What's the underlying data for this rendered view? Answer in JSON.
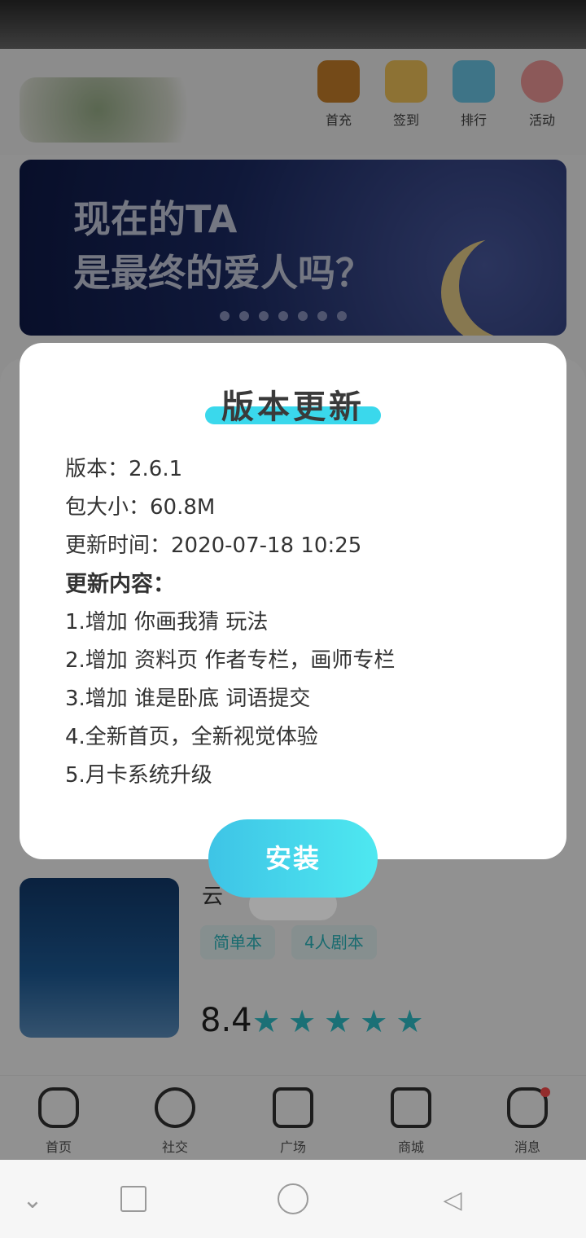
{
  "top_nav": {
    "items": [
      {
        "label": "首充",
        "icon": "treasure-chest-icon",
        "color": "#c9802a"
      },
      {
        "label": "签到",
        "icon": "calendar-check-icon",
        "color": "#f3c55a"
      },
      {
        "label": "排行",
        "icon": "trophy-icon",
        "color": "#6cc8e8"
      },
      {
        "label": "活动",
        "icon": "heart-icon",
        "color": "#f19a9a"
      }
    ]
  },
  "banner": {
    "line1": "现在的TA",
    "line2": "是最终的爱人吗？"
  },
  "book": {
    "title": "云",
    "tags": [
      "简单本",
      "4人剧本"
    ],
    "rating": "8.4",
    "stars": 5
  },
  "bottom_nav": {
    "items": [
      {
        "label": "首页",
        "icon": "cat-home-icon"
      },
      {
        "label": "社交",
        "icon": "social-circle-icon"
      },
      {
        "label": "广场",
        "icon": "plaza-icon"
      },
      {
        "label": "商城",
        "icon": "shop-icon"
      },
      {
        "label": "消息",
        "icon": "chat-bubble-icon"
      }
    ]
  },
  "dialog": {
    "title": "版本更新",
    "version": "版本：2.6.1",
    "size": "包大小：60.8M",
    "update_time": "更新时间：2020-07-18 10:25",
    "content_heading": "更新内容：",
    "items": [
      "1.增加 你画我猜 玩法",
      "2.增加 资料页 作者专栏，画师专栏",
      "3.增加 谁是卧底 词语提交",
      "4.全新首页，全新视觉体验",
      "5.月卡系统升级"
    ],
    "install_label": "安装"
  },
  "colors": {
    "accent": "#3ad8ec",
    "install_gradient_start": "#3ec4e6",
    "install_gradient_end": "#4ee8f0",
    "star": "#2fc2cc"
  }
}
